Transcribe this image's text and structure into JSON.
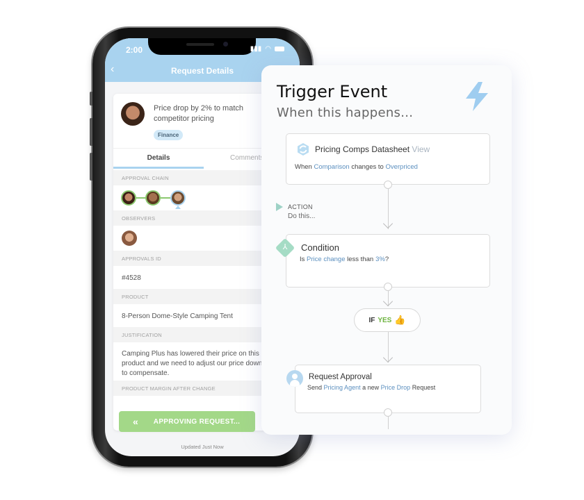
{
  "phone": {
    "status_time": "2:00",
    "nav_title": "Request Details",
    "request": {
      "title": "Price drop by 2% to match competitor pricing",
      "badge": "Finance"
    },
    "tabs": [
      {
        "label": "Details",
        "active": true
      },
      {
        "label": "Comments",
        "active": false
      }
    ],
    "sections": {
      "approval_chain_label": "APPROVAL CHAIN",
      "observers_label": "OBSERVERS",
      "approvals_id_label": "APPROVALS ID",
      "approvals_id_value": "#4528",
      "product_label": "PRODUCT",
      "product_value": "8-Person Dome-Style Camping Tent",
      "justification_label": "JUSTIFICATION",
      "justification_value": "Camping Plus has lowered their price on this product and we need to adjust our price down to compensate.",
      "margin_label": "PRODUCT MARGIN AFTER CHANGE"
    },
    "approve_button": {
      "chevron": "«",
      "label": "APPROVING REQUEST..."
    },
    "updated_text": "Updated Just Now",
    "colors": {
      "header": "#a9d3ef",
      "approve": "#a3d888",
      "chain": "#8bc86f"
    }
  },
  "trigger": {
    "title": "Trigger Event",
    "subtitle": "When this happens...",
    "icons": {
      "bolt": "lightning-bolt-icon",
      "sync": "sync-icon",
      "condition": "branch-icon",
      "thumb": "thumbs-up-icon",
      "person": "person-icon"
    },
    "source": {
      "name": "Pricing Comps Datasheet",
      "view_link": "View",
      "prefix": "When",
      "field": "Comparison",
      "middle": "changes to",
      "value": "Overpriced"
    },
    "action": {
      "label": "ACTION",
      "sub": "Do this..."
    },
    "condition": {
      "title": "Condition",
      "prefix": "Is",
      "field": "Price change",
      "middle": "less than",
      "value": "3%",
      "suffix": "?"
    },
    "branch": {
      "if": "IF",
      "yes": "YES",
      "thumb": "👍"
    },
    "request_approval": {
      "title": "Request Approval",
      "prefix": "Send",
      "agent": "Pricing Agent",
      "middle": "a new",
      "request_type": "Price Drop",
      "suffix": "Request"
    },
    "colors": {
      "link": "#5b8fbf",
      "bolt": "#9fcdf0",
      "yes": "#6db33f"
    }
  }
}
